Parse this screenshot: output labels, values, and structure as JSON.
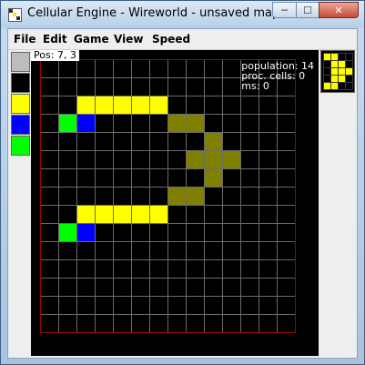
{
  "window": {
    "title": "Cellular Engine - Wireworld - unsaved map",
    "minimize_symbol": "─",
    "maximize_symbol": "☐",
    "close_symbol": "✕"
  },
  "menu": {
    "items": [
      "File",
      "Edit",
      "Game",
      "View",
      "Speed"
    ]
  },
  "palette": {
    "colors": [
      "#bdbdbd",
      "#000000",
      "#ffff00",
      "#0000ff",
      "#00ff00"
    ]
  },
  "board": {
    "position_label": "Pos: 7, 3",
    "stats": {
      "population": "population: 14",
      "proc_cells": "proc. cells: 0",
      "ms": "ms: 0"
    },
    "grid_color": "#6b6b6b",
    "border_color": "#a00000",
    "cell_colors": {
      "wire": "#ffff00",
      "head": "#0000ff",
      "tail": "#00ff00",
      "gate": "#808000"
    },
    "cols": 14,
    "rows": 15,
    "cells": [
      {
        "col": 2,
        "row": 2,
        "type": "wire"
      },
      {
        "col": 3,
        "row": 2,
        "type": "wire"
      },
      {
        "col": 4,
        "row": 2,
        "type": "wire"
      },
      {
        "col": 5,
        "row": 2,
        "type": "wire"
      },
      {
        "col": 6,
        "row": 2,
        "type": "wire"
      },
      {
        "col": 1,
        "row": 3,
        "type": "tail"
      },
      {
        "col": 2,
        "row": 3,
        "type": "head"
      },
      {
        "col": 7,
        "row": 3,
        "type": "gate"
      },
      {
        "col": 8,
        "row": 3,
        "type": "gate"
      },
      {
        "col": 9,
        "row": 4,
        "type": "gate"
      },
      {
        "col": 8,
        "row": 5,
        "type": "gate"
      },
      {
        "col": 9,
        "row": 5,
        "type": "gate"
      },
      {
        "col": 10,
        "row": 5,
        "type": "gate"
      },
      {
        "col": 9,
        "row": 6,
        "type": "gate"
      },
      {
        "col": 7,
        "row": 7,
        "type": "gate"
      },
      {
        "col": 8,
        "row": 7,
        "type": "gate"
      },
      {
        "col": 2,
        "row": 8,
        "type": "wire"
      },
      {
        "col": 3,
        "row": 8,
        "type": "wire"
      },
      {
        "col": 4,
        "row": 8,
        "type": "wire"
      },
      {
        "col": 5,
        "row": 8,
        "type": "wire"
      },
      {
        "col": 6,
        "row": 8,
        "type": "wire"
      },
      {
        "col": 1,
        "row": 9,
        "type": "tail"
      },
      {
        "col": 2,
        "row": 9,
        "type": "head"
      }
    ]
  },
  "preview": {
    "cols": 4,
    "rows": 5,
    "cells": [
      {
        "col": 0,
        "row": 0,
        "type": "wire"
      },
      {
        "col": 1,
        "row": 0,
        "type": "wire"
      },
      {
        "col": 1,
        "row": 1,
        "type": "wire"
      },
      {
        "col": 2,
        "row": 1,
        "type": "wire"
      },
      {
        "col": 1,
        "row": 2,
        "type": "wire"
      },
      {
        "col": 2,
        "row": 2,
        "type": "wire"
      },
      {
        "col": 3,
        "row": 2,
        "type": "wire"
      },
      {
        "col": 1,
        "row": 3,
        "type": "wire"
      },
      {
        "col": 2,
        "row": 3,
        "type": "wire"
      },
      {
        "col": 0,
        "row": 4,
        "type": "wire"
      },
      {
        "col": 1,
        "row": 4,
        "type": "wire"
      }
    ]
  }
}
